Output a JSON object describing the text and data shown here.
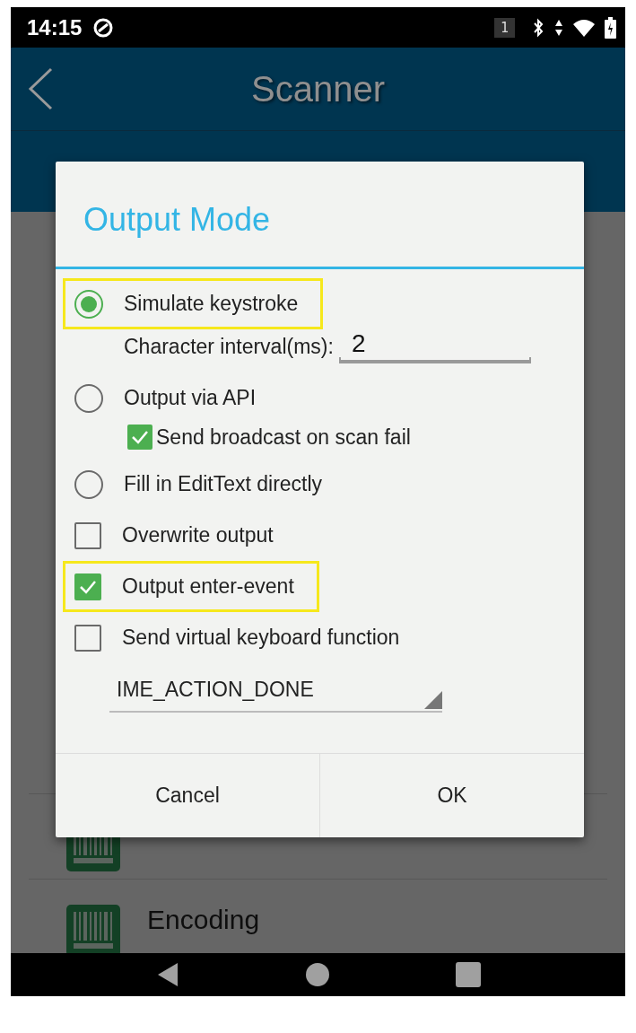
{
  "status_bar": {
    "time": "14:15",
    "sim_badge": "1"
  },
  "app_bar": {
    "title": "Scanner"
  },
  "background_list": [
    {
      "kind": "icon-row"
    },
    {
      "kind": "item",
      "label": "Encoding"
    }
  ],
  "dialog": {
    "title": "Output Mode",
    "options": [
      {
        "kind": "radio",
        "label": "Simulate keystroke",
        "selected": true,
        "highlighted": true,
        "field": {
          "label": "Character interval(ms):",
          "value": "2"
        }
      },
      {
        "kind": "radio",
        "label": "Output via API",
        "selected": false,
        "highlighted": false,
        "sub": {
          "label": "Send broadcast on scan fail",
          "checked": true
        }
      },
      {
        "kind": "radio",
        "label": "Fill in EditText directly",
        "selected": false,
        "highlighted": false
      },
      {
        "kind": "checkbox",
        "label": "Overwrite output",
        "checked": false,
        "highlighted": false
      },
      {
        "kind": "checkbox",
        "label": "Output enter-event",
        "checked": true,
        "highlighted": true
      },
      {
        "kind": "checkbox",
        "label": "Send virtual keyboard function",
        "checked": false,
        "highlighted": false
      }
    ],
    "spinner": {
      "value": "IME_ACTION_DONE"
    },
    "buttons": [
      "Cancel",
      "OK"
    ]
  }
}
